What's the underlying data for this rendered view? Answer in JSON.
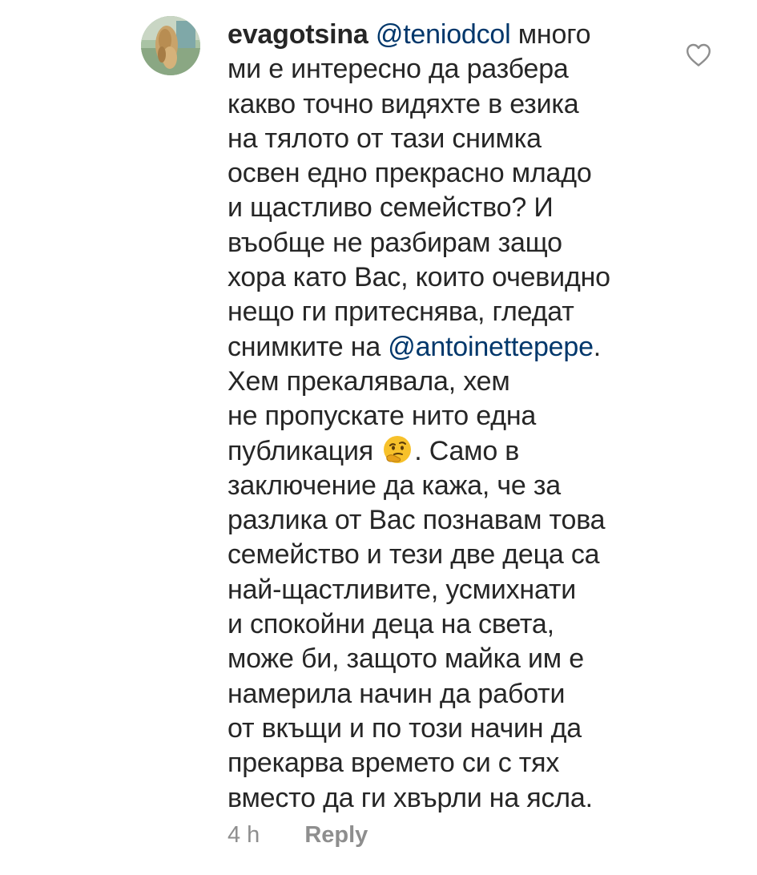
{
  "comment": {
    "username": "evagotsina",
    "mention_1": "@teniodcol",
    "mention_2": "@antoinettepepe",
    "emoji": "thinking-face-emoji",
    "lines": {
      "l1": "много",
      "l2": "ми е интересно да разбера",
      "l3": "какво точно видяхте в езика",
      "l4": "на тялото от тази снимка",
      "l5": "освен едно прекрасно младо",
      "l6": "и щастливо семейство? И",
      "l7": "въобще не разбирам защо",
      "l8": "хора като Вас, които очевидно",
      "l9": "нещо ги притеснява, гледат",
      "l10_pre": "снимките на",
      "l10_post": ".",
      "l11": "Хем прекалявала, хем",
      "l12": "не пропускате нито една",
      "l13_pre": "публикация",
      "l13_post": ". Само в",
      "l14": "заключение да кажа, че за",
      "l15": "разлика от Вас познавам това",
      "l16": "семейство и тези две деца са",
      "l17": "най-щастливите, усмихнати",
      "l18": "и спокойни деца на света,",
      "l19": "може би, защото майка им е",
      "l20": "намерила начин да работи",
      "l21": "от вкъщи и по този начин да",
      "l22": "прекарва времето си с тях",
      "l23": "вместо да ги хвърли на ясла."
    },
    "timestamp": "4 h",
    "reply_label": "Reply",
    "like_icon": "heart-outline-icon"
  },
  "colors": {
    "text": "#262626",
    "mention": "#00376b",
    "muted": "#8e8e8e"
  }
}
